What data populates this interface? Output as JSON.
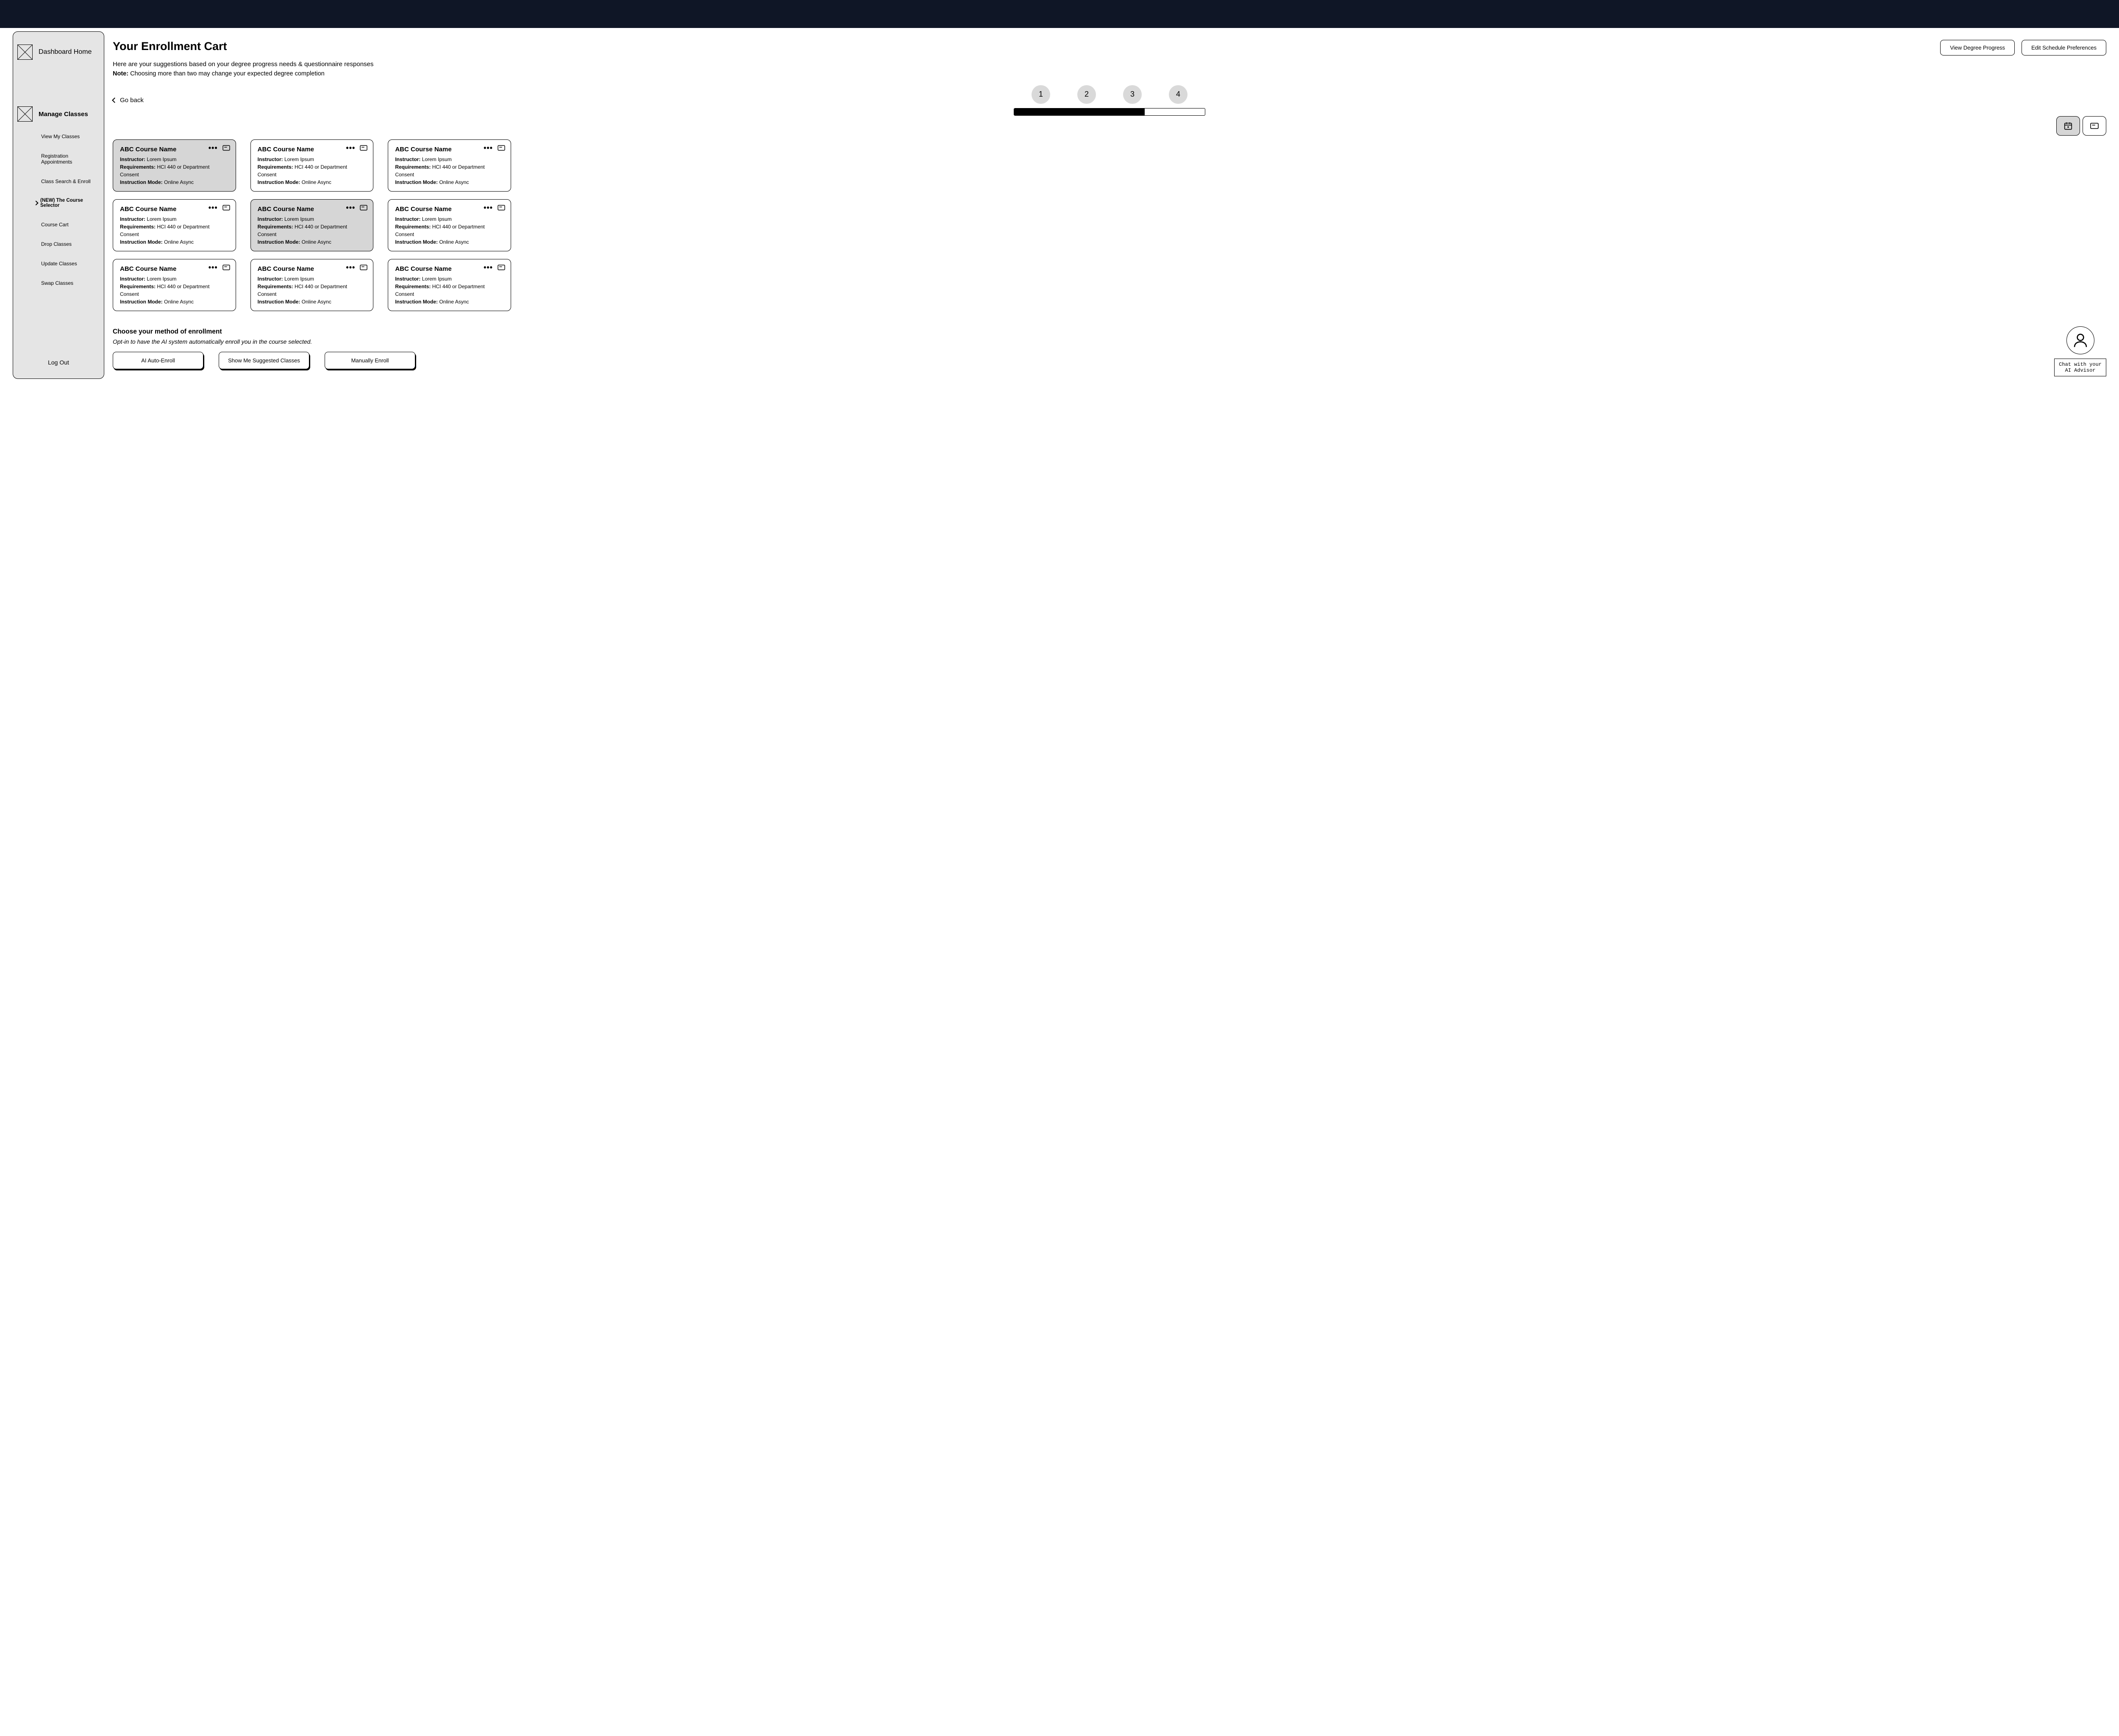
{
  "sidebar": {
    "dashboard_label": "Dashboard Home",
    "section_header": "Manage Classes",
    "items": [
      {
        "label": "View My Classes"
      },
      {
        "label": "Registration Appointments"
      },
      {
        "label": "Class Search & Enroll"
      },
      {
        "label": "(NEW) The Course Selector"
      },
      {
        "label": "Course Cart"
      },
      {
        "label": "Drop Classes"
      },
      {
        "label": "Update Classes"
      },
      {
        "label": "Swap Classes"
      }
    ],
    "logout_label": "Log Out"
  },
  "header": {
    "title": "Your Enrollment Cart",
    "view_progress_btn": "View Degree Progress",
    "edit_prefs_btn": "Edit Schedule Preferences",
    "subtext": "Here are your suggestions based on your degree progress needs & questionnaire responses",
    "note_prefix": "Note:",
    "note_text": " Choosing more than two may change your expected degree completion"
  },
  "stepper": {
    "go_back": "Go back",
    "steps": [
      "1",
      "2",
      "3",
      "4"
    ]
  },
  "card_labels": {
    "instructor": "Instructor:",
    "requirements": "Requirements:",
    "mode": "Instruction Mode:"
  },
  "cards": [
    {
      "title": "ABC Course Name",
      "instructor": "Lorem Ipsum",
      "requirements": "HCI 440 or Department Consent",
      "mode": "Online Async",
      "selected": true
    },
    {
      "title": "ABC Course Name",
      "instructor": "Lorem Ipsum",
      "requirements": "HCI 440 or Department Consent",
      "mode": "Online Async",
      "selected": false
    },
    {
      "title": "ABC Course Name",
      "instructor": "Lorem Ipsum",
      "requirements": "HCI 440 or Department Consent",
      "mode": "Online Async",
      "selected": false
    },
    {
      "title": "ABC Course Name",
      "instructor": "Lorem Ipsum",
      "requirements": "HCI 440 or Department Consent",
      "mode": "Online Async",
      "selected": false
    },
    {
      "title": "ABC Course Name",
      "instructor": "Lorem Ipsum",
      "requirements": "HCI 440 or Department Consent",
      "mode": "Online Async",
      "selected": true
    },
    {
      "title": "ABC Course Name",
      "instructor": "Lorem Ipsum",
      "requirements": "HCI 440 or Department Consent",
      "mode": "Online Async",
      "selected": false
    },
    {
      "title": "ABC Course Name",
      "instructor": "Lorem Ipsum",
      "requirements": "HCI 440 or Department Consent",
      "mode": "Online Async",
      "selected": false
    },
    {
      "title": "ABC Course Name",
      "instructor": "Lorem Ipsum",
      "requirements": "HCI 440 or Department Consent",
      "mode": "Online Async",
      "selected": false
    },
    {
      "title": "ABC Course Name",
      "instructor": "Lorem Ipsum",
      "requirements": "HCI 440 or Department Consent",
      "mode": "Online Async",
      "selected": false
    }
  ],
  "enroll": {
    "title": "Choose your method of enrollment",
    "sub": "Opt-in to have the AI system automatically enroll you in the course selected.",
    "btn_auto": "AI Auto-Enroll",
    "btn_suggest": "Show Me Suggested Classes",
    "btn_manual": "Manually Enroll"
  },
  "advisor": {
    "label": "Chat with your\nAI Advisor"
  }
}
